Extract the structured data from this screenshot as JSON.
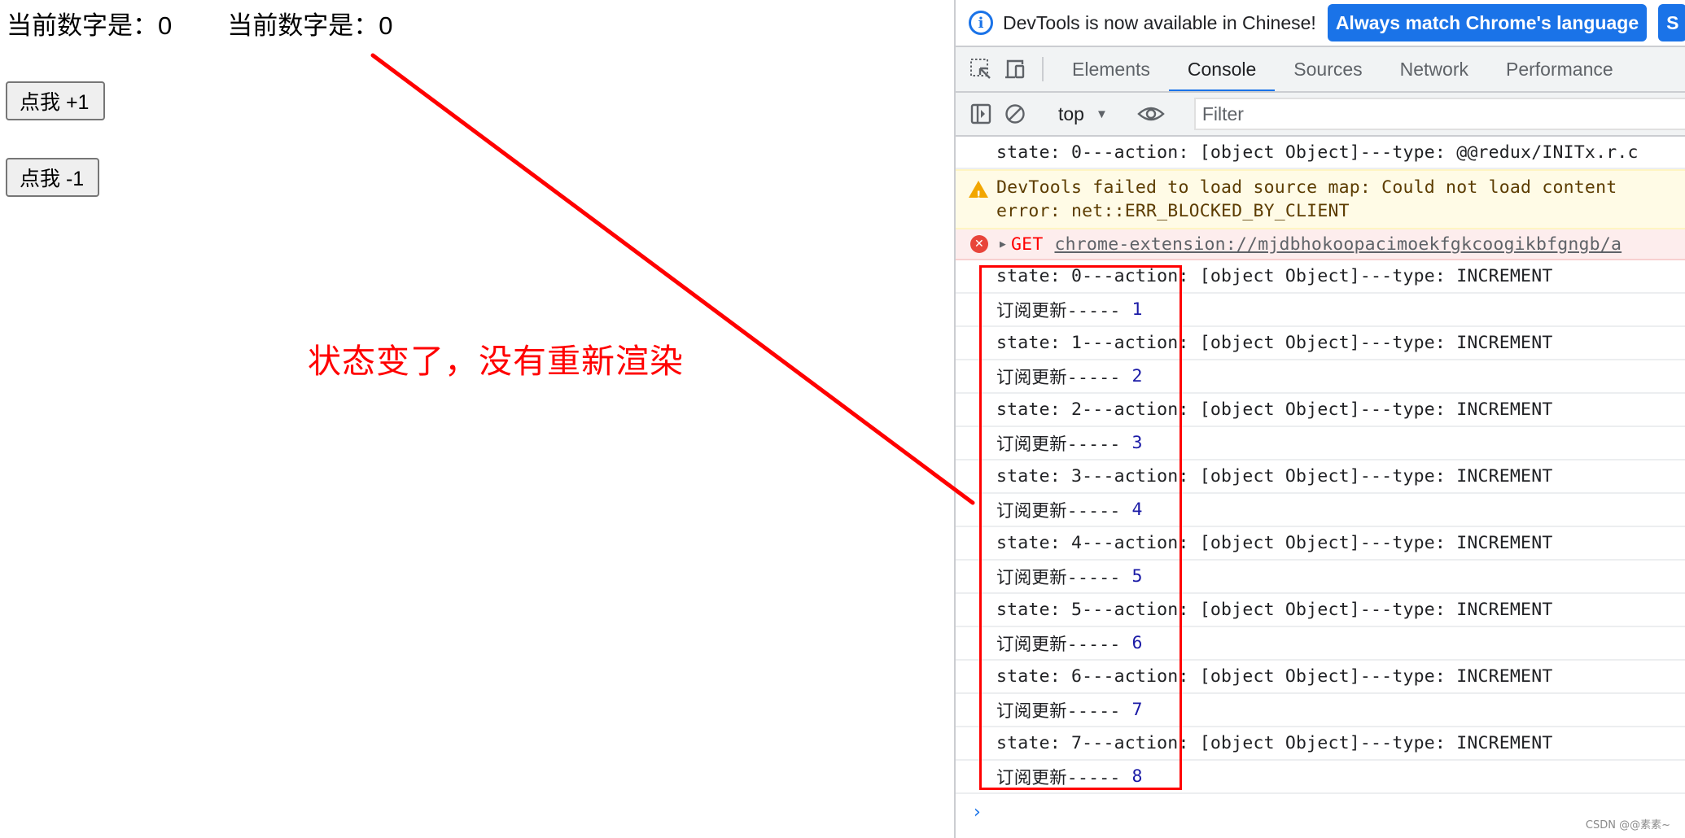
{
  "page": {
    "headings": [
      "当前数字是：0",
      "当前数字是：0"
    ],
    "buttons": {
      "increment": "点我 +1",
      "decrement": "点我 -1"
    }
  },
  "annotation": {
    "text": "状态变了，没有重新渲染",
    "color": "#ff0000"
  },
  "devtools": {
    "infobar": {
      "icon": "info-icon",
      "message": "DevTools is now available in Chinese!",
      "primary_button": "Always match Chrome's language",
      "secondary_button_partial": "S"
    },
    "toolbar_icons": [
      "inspect-element-icon",
      "device-toggle-icon"
    ],
    "tabs": [
      {
        "label": "Elements",
        "active": false
      },
      {
        "label": "Console",
        "active": true
      },
      {
        "label": "Sources",
        "active": false
      },
      {
        "label": "Network",
        "active": false
      },
      {
        "label": "Performance",
        "active": false
      }
    ],
    "console_toolbar": {
      "icons": [
        "sidebar-toggle-icon",
        "clear-console-icon"
      ],
      "context": "top",
      "eye_icon": "live-expression-eye-icon",
      "filter_placeholder": "Filter"
    },
    "console": {
      "init_line": "state: 0---action: [object Object]---type: @@redux/INITx.r.c",
      "warning": {
        "line1": "DevTools failed to load source map: Could not load content",
        "line2": "error: net::ERR_BLOCKED_BY_CLIENT"
      },
      "error": {
        "method": "GET",
        "url": "chrome-extension://mjdbhokoopacimoekfgkcoogikbfgngb/a"
      },
      "entries": [
        {
          "state": "state: 0---action: [object Object]---type: INCREMENT",
          "sub_label": "订阅更新-----",
          "sub_value": "1"
        },
        {
          "state": "state: 1---action: [object Object]---type: INCREMENT",
          "sub_label": "订阅更新-----",
          "sub_value": "2"
        },
        {
          "state": "state: 2---action: [object Object]---type: INCREMENT",
          "sub_label": "订阅更新-----",
          "sub_value": "3"
        },
        {
          "state": "state: 3---action: [object Object]---type: INCREMENT",
          "sub_label": "订阅更新-----",
          "sub_value": "4"
        },
        {
          "state": "state: 4---action: [object Object]---type: INCREMENT",
          "sub_label": "订阅更新-----",
          "sub_value": "5"
        },
        {
          "state": "state: 5---action: [object Object]---type: INCREMENT",
          "sub_label": "订阅更新-----",
          "sub_value": "6"
        },
        {
          "state": "state: 6---action: [object Object]---type: INCREMENT",
          "sub_label": "订阅更新-----",
          "sub_value": "7"
        },
        {
          "state": "state: 7---action: [object Object]---type: INCREMENT",
          "sub_label": "订阅更新-----",
          "sub_value": "8"
        }
      ],
      "prompt": "›"
    }
  },
  "watermark": "CSDN @@素素~"
}
